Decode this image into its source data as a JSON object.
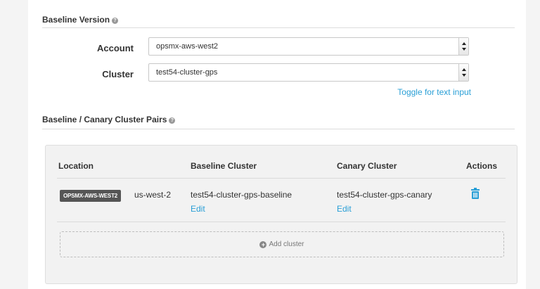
{
  "baseline": {
    "section_title": "Baseline Version",
    "account": {
      "label": "Account",
      "value": "opsmx-aws-west2"
    },
    "cluster": {
      "label": "Cluster",
      "value": "test54-cluster-gps"
    },
    "toggle_link": "Toggle for text input"
  },
  "pairs": {
    "section_title": "Baseline / Canary Cluster Pairs",
    "columns": {
      "location": "Location",
      "baseline": "Baseline Cluster",
      "canary": "Canary Cluster",
      "actions": "Actions"
    },
    "rows": [
      {
        "account_badge": "OPSMX-AWS-WEST2",
        "region": "us-west-2",
        "baseline_cluster": "test54-cluster-gps-baseline",
        "baseline_edit": "Edit",
        "canary_cluster": "test54-cluster-gps-canary",
        "canary_edit": "Edit",
        "action_icon": "trash-icon"
      }
    ],
    "add_cluster_label": "Add cluster"
  },
  "colors": {
    "link": "#2a9fd6",
    "badge_bg": "#555555",
    "panel_bg": "#f2f2f2"
  }
}
